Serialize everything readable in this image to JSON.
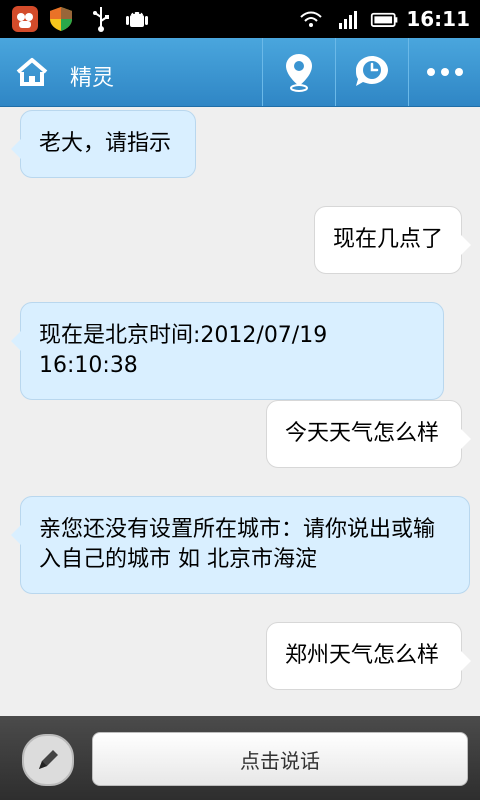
{
  "status_bar": {
    "time": "16:11"
  },
  "app_bar": {
    "title": "精灵"
  },
  "messages": [
    {
      "side": "left",
      "text": "老大，请指示"
    },
    {
      "side": "right",
      "text": "现在几点了"
    },
    {
      "side": "left",
      "text": "现在是北京时间:2012/07/19 16:10:38"
    },
    {
      "side": "right",
      "text": "今天天气怎么样"
    },
    {
      "side": "left",
      "text": "亲您还没有设置所在城市：请你说出或输入自己的城市 如 北京市海淀"
    },
    {
      "side": "right",
      "text": "郑州天气怎么样"
    }
  ],
  "bottom_bar": {
    "speak_label": "点击说话"
  },
  "icons": {
    "status_left": [
      "app-icon",
      "shield-icon",
      "usb-icon",
      "android-icon"
    ],
    "status_right": [
      "wifi-icon",
      "signal-icon",
      "battery-icon"
    ],
    "app_bar": [
      "home-icon",
      "location-pin-icon",
      "clock-chat-icon",
      "more-icon"
    ],
    "bottom": [
      "pencil-icon"
    ]
  }
}
